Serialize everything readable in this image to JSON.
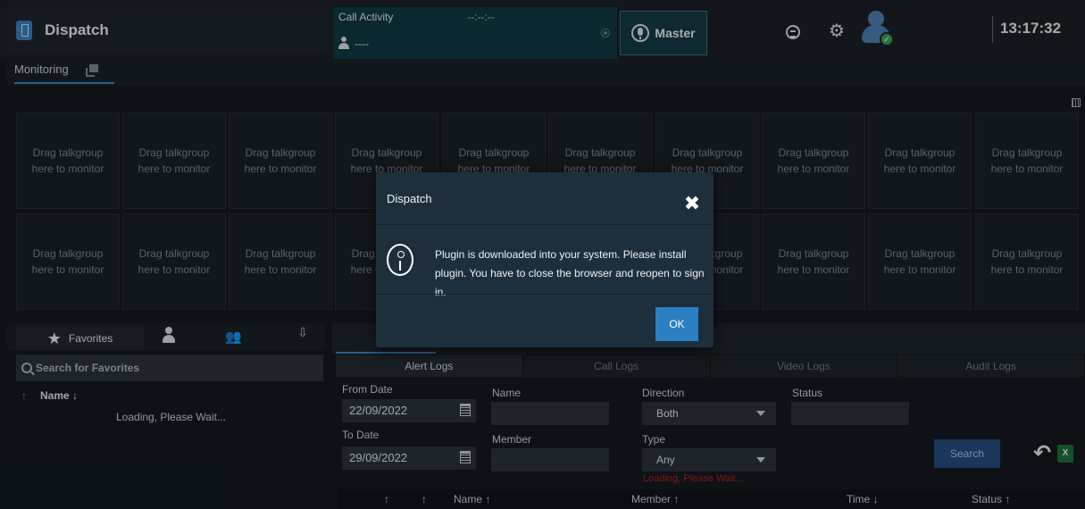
{
  "header": {
    "app_title": "Dispatch",
    "call_activity_title": "Call Activity",
    "call_activity_time": "--:--:--",
    "call_activity_user": "----",
    "master_label": "Master",
    "clock": "13:17:32"
  },
  "monitoring": {
    "tab_label": "Monitoring",
    "tile_line1": "Drag talkgroup",
    "tile_line2": "here to monitor"
  },
  "favorites": {
    "tab_label": "Favorites",
    "search_placeholder": "Search for Favorites",
    "name_column": "Name ↓",
    "sort_arrow": "↑",
    "loading": "Loading, Please Wait..."
  },
  "logs": {
    "tabs": [
      "Alert Logs",
      "Call Logs",
      "Video Logs",
      "Audit Logs"
    ],
    "from_date_label": "From Date",
    "from_date_value": "22/09/2022",
    "to_date_label": "To Date",
    "to_date_value": "29/09/2022",
    "name_label": "Name",
    "member_label": "Member",
    "direction_label": "Direction",
    "direction_value": "Both",
    "type_label": "Type",
    "type_value": "Any",
    "type_loading": "Loading, Please Wait...",
    "status_label": "Status",
    "search_button": "Search",
    "excel_label": "X",
    "columns": {
      "sort1": "↑",
      "sort2": "↑",
      "name": "Name ↑",
      "member": "Member ↑",
      "time": "Time ↓",
      "status": "Status ↑"
    }
  },
  "modal": {
    "title": "Dispatch",
    "close": "✖",
    "message": "Plugin is downloaded into your system. Please install plugin. You have to close the browser and reopen to sign in.",
    "ok_label": "OK"
  },
  "colors": {
    "accent": "#3a87c7",
    "modal_bg": "#1d2f3d",
    "ok_button": "#2c7fc0",
    "status_online": "#3aa15a",
    "error_text": "#b02020"
  },
  "icons": [
    "dispatch-logo-icon",
    "user-icon",
    "mic-icon",
    "refresh-icon",
    "gear-icon",
    "avatar",
    "star-icon",
    "group-icon",
    "search-icon",
    "calendar-icon",
    "undo-icon",
    "excel-icon",
    "info-icon",
    "close-icon",
    "grid-icon"
  ]
}
